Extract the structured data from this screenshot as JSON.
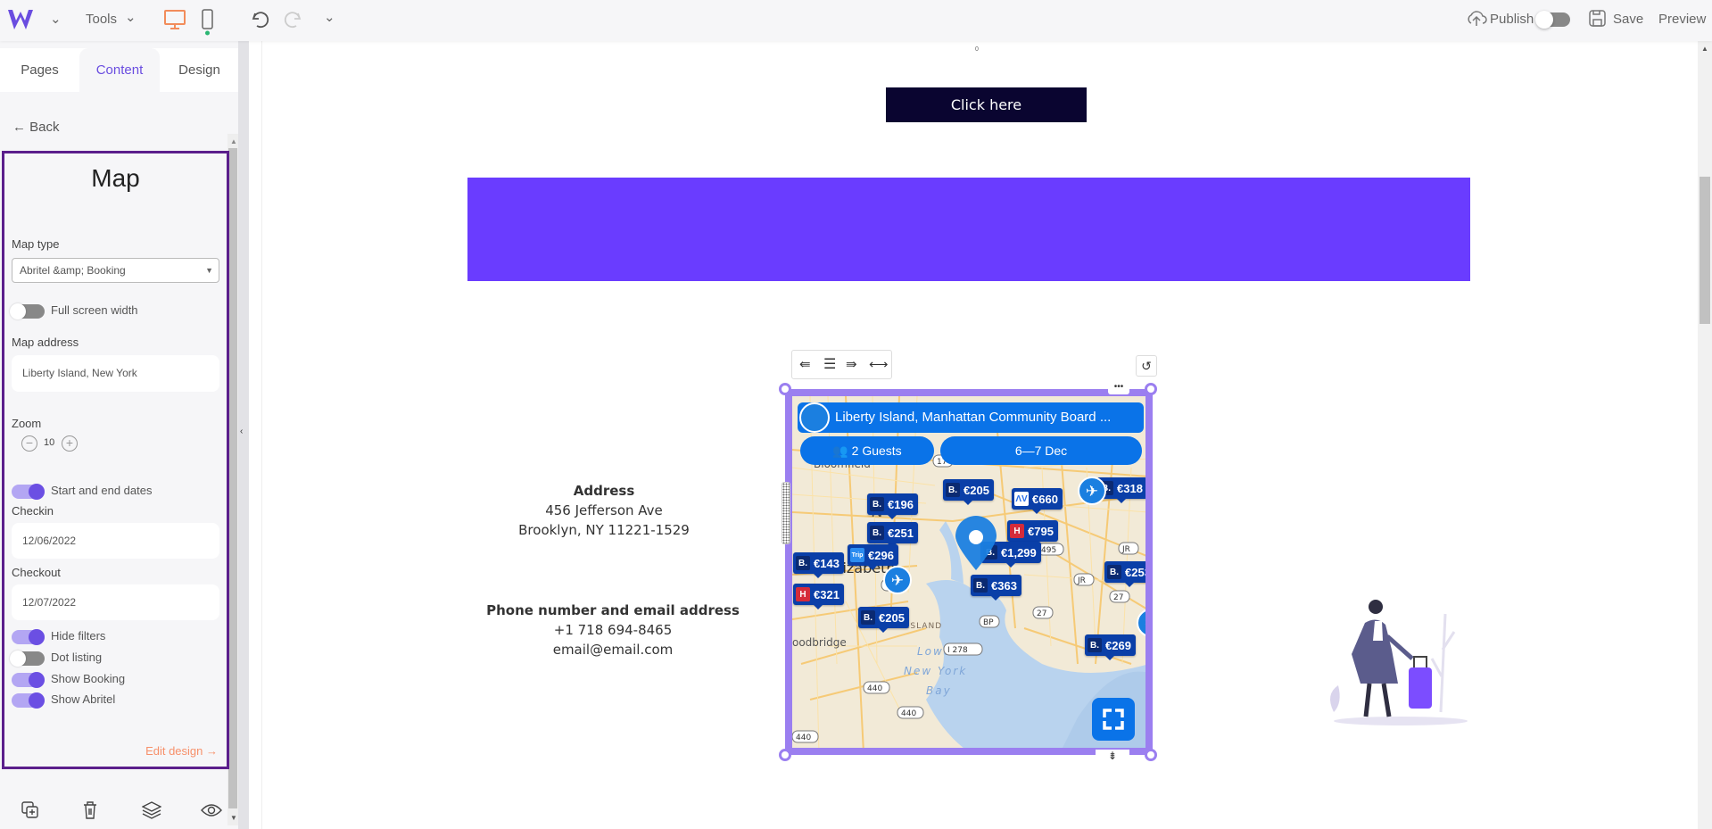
{
  "topbar": {
    "tools_label": "Tools",
    "publish_label": "Publish",
    "save_label": "Save",
    "preview_label": "Preview",
    "publish_on": false,
    "accent": "#f28c5b"
  },
  "sidebar": {
    "tabs": [
      {
        "label": "Pages"
      },
      {
        "label": "Content",
        "active": true
      },
      {
        "label": "Design"
      }
    ],
    "back_label": "Back",
    "panel": {
      "title": "Map",
      "map_type_label": "Map type",
      "map_type_value": "Abritel &amp; Booking",
      "full_width_label": "Full screen width",
      "full_width_on": false,
      "address_label": "Map address",
      "address_value": "Liberty Island, New York",
      "zoom_label": "Zoom",
      "zoom_value": "10",
      "dates_label": "Start and end dates",
      "dates_on": true,
      "checkin_label": "Checkin",
      "checkin_value": "12/06/2022",
      "checkout_label": "Checkout",
      "checkout_value": "12/07/2022",
      "toggles": [
        {
          "label": "Hide filters",
          "on": true
        },
        {
          "label": "Dot listing",
          "on": false
        },
        {
          "label": "Show Booking",
          "on": true
        },
        {
          "label": "Show Abritel",
          "on": true
        }
      ],
      "edit_design_label": "Edit design →",
      "border_color": "#5b1f8c"
    }
  },
  "canvas": {
    "ruler_zero": "0",
    "cta_label": "Click here",
    "banner_color": "#6a3cff",
    "address_title": "Address",
    "address_line1": "456 Jefferson Ave",
    "address_line2": "Brooklyn, NY 11221-1529",
    "contact_title": "Phone number and email address",
    "phone": "+1 718 694-8465",
    "email": "email@email.com"
  },
  "map": {
    "search_label": "Liberty Island, Manhattan Community Board ...",
    "guests_label": "2 Guests",
    "dates_label": "6—7 Dec",
    "place_labels": [
      "Bloomfield",
      "N",
      "lizabeth",
      "STATEN ISLAND",
      "oodbridge",
      "Lower",
      "New York",
      "Bay"
    ],
    "road_labels": [
      "17",
      "78",
      "JR",
      "JR",
      "27",
      "27",
      "BP",
      "I 278",
      "440",
      "440",
      "440",
      "495"
    ],
    "markers": [
      {
        "provider": "booking",
        "price": "€205"
      },
      {
        "provider": "abritel",
        "price": "€660"
      },
      {
        "provider": "booking",
        "price": "€318"
      },
      {
        "provider": "booking",
        "price": "€196"
      },
      {
        "provider": "booking",
        "price": "€251"
      },
      {
        "provider": "hotels",
        "price": "€795"
      },
      {
        "provider": "booking",
        "price": "€1,299"
      },
      {
        "provider": "trip",
        "price": "€296"
      },
      {
        "provider": "booking",
        "price": "€143"
      },
      {
        "provider": "booking",
        "price": "€363"
      },
      {
        "provider": "booking",
        "price": "€253"
      },
      {
        "provider": "hotels",
        "price": "€321"
      },
      {
        "provider": "booking",
        "price": "€205"
      },
      {
        "provider": "booking",
        "price": "€269"
      }
    ],
    "selection_color": "#9b7ff0",
    "brand_blue": "#0a73e8"
  }
}
